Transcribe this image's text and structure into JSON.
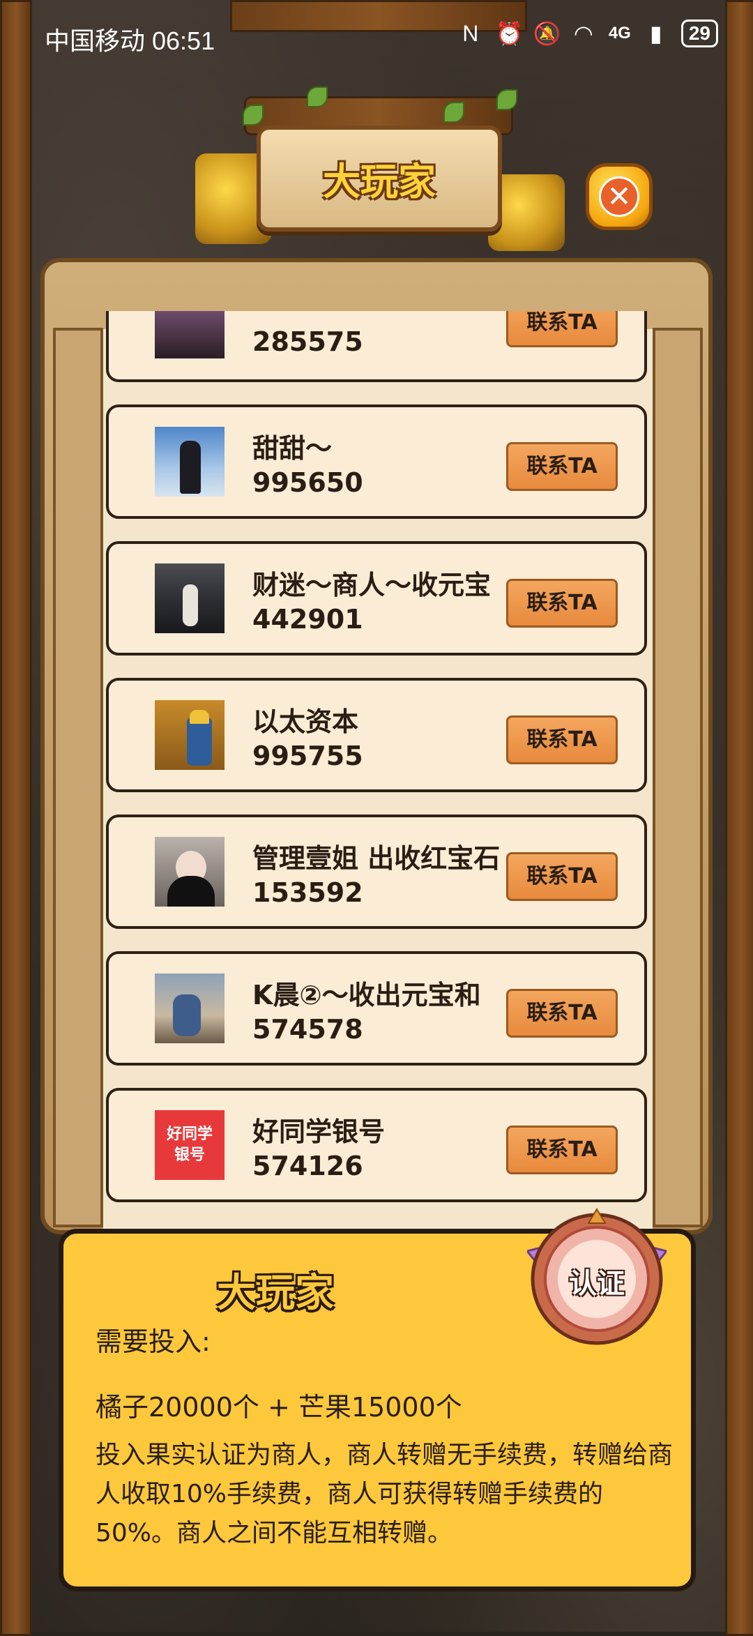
{
  "status_bar": {
    "carrier_time": "中国移动 06:51",
    "network": "4G",
    "battery": "29"
  },
  "title": "大玩家",
  "players": [
    {
      "name": "",
      "id": "285575",
      "button": "联系TA",
      "avatar": "person-dark"
    },
    {
      "name": "甜甜～",
      "id": "995650",
      "button": "联系TA",
      "avatar": "person-sky"
    },
    {
      "name": "财迷～商人～收元宝",
      "id": "442901",
      "button": "联系TA",
      "avatar": "person-theater"
    },
    {
      "name": "以太资本",
      "id": "995755",
      "button": "联系TA",
      "avatar": "miner-game"
    },
    {
      "name": "管理壹姐 出收红宝石",
      "id": "153592",
      "button": "联系TA",
      "avatar": "person-portrait"
    },
    {
      "name": "K晨②～收出元宝和",
      "id": "574578",
      "button": "联系TA",
      "avatar": "person-anime"
    },
    {
      "name": "好同学银号",
      "id": "574126",
      "button": "联系TA",
      "avatar_text_1": "好同学",
      "avatar_text_2": "银号"
    }
  ],
  "info": {
    "title": "大玩家",
    "badge": "认证",
    "label": "需要投入:",
    "cost": "橘子20000个 + 芒果15000个",
    "description": "投入果实认证为商人，商人转赠无手续费，转赠给商人收取10%手续费，商人可获得转赠手续费的50%。商人之间不能互相转赠。"
  },
  "colors": {
    "gold": "#fdc83b",
    "button": "#e78a3d",
    "card": "#fbecd6"
  }
}
